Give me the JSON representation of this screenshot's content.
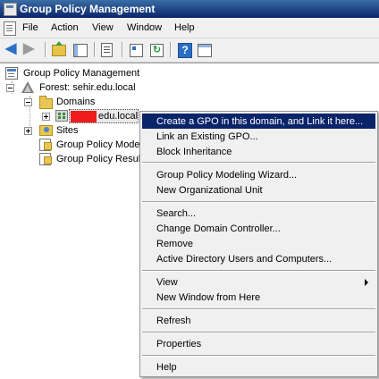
{
  "window": {
    "title": "Group Policy Management"
  },
  "menubar": {
    "items": [
      "File",
      "Action",
      "View",
      "Window",
      "Help"
    ]
  },
  "toolbar": {
    "back_icon": "back-arrow-icon",
    "forward_icon": "forward-arrow-icon",
    "help_glyph": "?"
  },
  "tree": {
    "root": "Group Policy Management",
    "forest": "Forest: sehir.edu.local",
    "domains": "Domains",
    "domain_suffix": "edu.local",
    "sites": "Sites",
    "modeling": "Group Policy Modeli",
    "results": "Group Policy Result"
  },
  "context_menu": {
    "items": [
      "Create a GPO in this domain, and Link it here...",
      "Link an Existing GPO...",
      "Block Inheritance",
      "Group Policy Modeling Wizard...",
      "New Organizational Unit",
      "Search...",
      "Change Domain Controller...",
      "Remove",
      "Active Directory Users and Computers...",
      "View",
      "New Window from Here",
      "Refresh",
      "Properties",
      "Help"
    ],
    "selected_index": 0,
    "submenu_item": "View"
  }
}
